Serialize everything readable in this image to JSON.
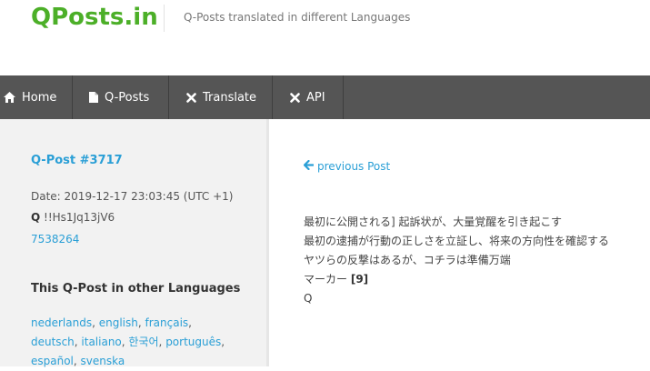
{
  "header": {
    "logo": "QPosts.in",
    "tagline": "Q-Posts translated in different Languages",
    "brand_color": "#4caf28"
  },
  "nav": {
    "items": [
      {
        "label": "Home",
        "icon": "home-icon"
      },
      {
        "label": "Q-Posts",
        "icon": "document-icon"
      },
      {
        "label": "Translate",
        "icon": "cross-icon"
      },
      {
        "label": "API",
        "icon": "cross-icon"
      }
    ],
    "background": "#555555"
  },
  "sidebar": {
    "post_title": "Q-Post #3717",
    "date": "Date: 2019-12-17 23:03:45 (UTC +1)",
    "author": "Q",
    "tripcode": "!!Hs1Jq13jV6",
    "post_id": "7538264",
    "other_languages_title": "This Q-Post in other Languages",
    "languages": [
      "nederlands",
      "english",
      "français",
      "deutsch",
      "italiano",
      "한국어",
      "português",
      "español",
      "svenska"
    ]
  },
  "main": {
    "previous_link": "previous Post",
    "lines": [
      "最初に公開される] 起訴状が、大量覚醒を引き起こす",
      "最初の逮捕が行動の正しさを立証し、将来の方向性を確認する",
      "ヤツらの反撃はあるが、コチラは準備万端",
      "マーカー",
      "Q"
    ],
    "marker_ref": "[9]",
    "link_color": "#2a9fd6"
  }
}
